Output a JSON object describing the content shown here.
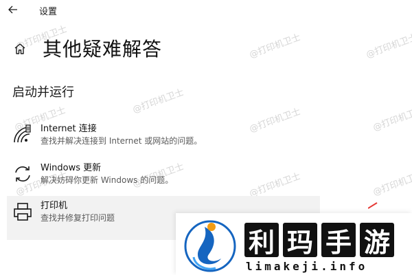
{
  "window": {
    "title": "设置"
  },
  "page": {
    "title": "其他疑难解答"
  },
  "section": {
    "heading": "启动并运行"
  },
  "items": [
    {
      "title": "Internet 连接",
      "description": "查找并解决连接到 Internet 或网站的问题。",
      "icon": "wifi-icon"
    },
    {
      "title": "Windows 更新",
      "description": "解决妨碍你更新 Windows 的问题。",
      "icon": "refresh-icon"
    },
    {
      "title": "打印机",
      "description": "查找并修复打印问题",
      "icon": "printer-icon"
    }
  ],
  "watermark": {
    "text": "@打印机卫士"
  },
  "logo": {
    "chars": [
      "利",
      "玛",
      "手",
      "游"
    ],
    "domain": "limakeji.info"
  },
  "colors": {
    "selected_bg": "#f2f2f2",
    "text": "#1a1a1a",
    "secondary_text": "#5a5a5a",
    "watermark": "#cfcfcf",
    "logo_blue": "#1565c0",
    "logo_orange": "#f39c12"
  }
}
